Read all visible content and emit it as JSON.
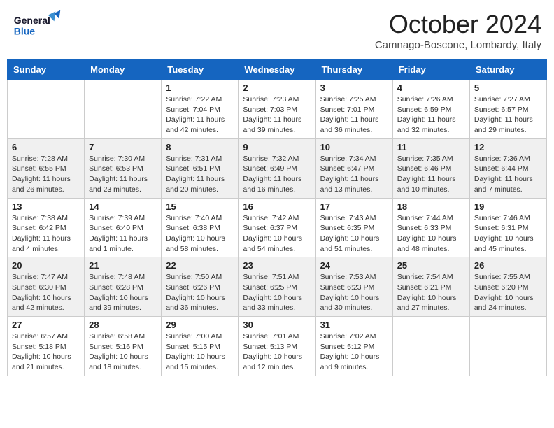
{
  "header": {
    "logo_general": "General",
    "logo_blue": "Blue",
    "month_title": "October 2024",
    "location": "Camnago-Boscone, Lombardy, Italy"
  },
  "weekdays": [
    "Sunday",
    "Monday",
    "Tuesday",
    "Wednesday",
    "Thursday",
    "Friday",
    "Saturday"
  ],
  "weeks": [
    [
      {
        "day": "",
        "sunrise": "",
        "sunset": "",
        "daylight": ""
      },
      {
        "day": "",
        "sunrise": "",
        "sunset": "",
        "daylight": ""
      },
      {
        "day": "1",
        "sunrise": "Sunrise: 7:22 AM",
        "sunset": "Sunset: 7:04 PM",
        "daylight": "Daylight: 11 hours and 42 minutes."
      },
      {
        "day": "2",
        "sunrise": "Sunrise: 7:23 AM",
        "sunset": "Sunset: 7:03 PM",
        "daylight": "Daylight: 11 hours and 39 minutes."
      },
      {
        "day": "3",
        "sunrise": "Sunrise: 7:25 AM",
        "sunset": "Sunset: 7:01 PM",
        "daylight": "Daylight: 11 hours and 36 minutes."
      },
      {
        "day": "4",
        "sunrise": "Sunrise: 7:26 AM",
        "sunset": "Sunset: 6:59 PM",
        "daylight": "Daylight: 11 hours and 32 minutes."
      },
      {
        "day": "5",
        "sunrise": "Sunrise: 7:27 AM",
        "sunset": "Sunset: 6:57 PM",
        "daylight": "Daylight: 11 hours and 29 minutes."
      }
    ],
    [
      {
        "day": "6",
        "sunrise": "Sunrise: 7:28 AM",
        "sunset": "Sunset: 6:55 PM",
        "daylight": "Daylight: 11 hours and 26 minutes."
      },
      {
        "day": "7",
        "sunrise": "Sunrise: 7:30 AM",
        "sunset": "Sunset: 6:53 PM",
        "daylight": "Daylight: 11 hours and 23 minutes."
      },
      {
        "day": "8",
        "sunrise": "Sunrise: 7:31 AM",
        "sunset": "Sunset: 6:51 PM",
        "daylight": "Daylight: 11 hours and 20 minutes."
      },
      {
        "day": "9",
        "sunrise": "Sunrise: 7:32 AM",
        "sunset": "Sunset: 6:49 PM",
        "daylight": "Daylight: 11 hours and 16 minutes."
      },
      {
        "day": "10",
        "sunrise": "Sunrise: 7:34 AM",
        "sunset": "Sunset: 6:47 PM",
        "daylight": "Daylight: 11 hours and 13 minutes."
      },
      {
        "day": "11",
        "sunrise": "Sunrise: 7:35 AM",
        "sunset": "Sunset: 6:46 PM",
        "daylight": "Daylight: 11 hours and 10 minutes."
      },
      {
        "day": "12",
        "sunrise": "Sunrise: 7:36 AM",
        "sunset": "Sunset: 6:44 PM",
        "daylight": "Daylight: 11 hours and 7 minutes."
      }
    ],
    [
      {
        "day": "13",
        "sunrise": "Sunrise: 7:38 AM",
        "sunset": "Sunset: 6:42 PM",
        "daylight": "Daylight: 11 hours and 4 minutes."
      },
      {
        "day": "14",
        "sunrise": "Sunrise: 7:39 AM",
        "sunset": "Sunset: 6:40 PM",
        "daylight": "Daylight: 11 hours and 1 minute."
      },
      {
        "day": "15",
        "sunrise": "Sunrise: 7:40 AM",
        "sunset": "Sunset: 6:38 PM",
        "daylight": "Daylight: 10 hours and 58 minutes."
      },
      {
        "day": "16",
        "sunrise": "Sunrise: 7:42 AM",
        "sunset": "Sunset: 6:37 PM",
        "daylight": "Daylight: 10 hours and 54 minutes."
      },
      {
        "day": "17",
        "sunrise": "Sunrise: 7:43 AM",
        "sunset": "Sunset: 6:35 PM",
        "daylight": "Daylight: 10 hours and 51 minutes."
      },
      {
        "day": "18",
        "sunrise": "Sunrise: 7:44 AM",
        "sunset": "Sunset: 6:33 PM",
        "daylight": "Daylight: 10 hours and 48 minutes."
      },
      {
        "day": "19",
        "sunrise": "Sunrise: 7:46 AM",
        "sunset": "Sunset: 6:31 PM",
        "daylight": "Daylight: 10 hours and 45 minutes."
      }
    ],
    [
      {
        "day": "20",
        "sunrise": "Sunrise: 7:47 AM",
        "sunset": "Sunset: 6:30 PM",
        "daylight": "Daylight: 10 hours and 42 minutes."
      },
      {
        "day": "21",
        "sunrise": "Sunrise: 7:48 AM",
        "sunset": "Sunset: 6:28 PM",
        "daylight": "Daylight: 10 hours and 39 minutes."
      },
      {
        "day": "22",
        "sunrise": "Sunrise: 7:50 AM",
        "sunset": "Sunset: 6:26 PM",
        "daylight": "Daylight: 10 hours and 36 minutes."
      },
      {
        "day": "23",
        "sunrise": "Sunrise: 7:51 AM",
        "sunset": "Sunset: 6:25 PM",
        "daylight": "Daylight: 10 hours and 33 minutes."
      },
      {
        "day": "24",
        "sunrise": "Sunrise: 7:53 AM",
        "sunset": "Sunset: 6:23 PM",
        "daylight": "Daylight: 10 hours and 30 minutes."
      },
      {
        "day": "25",
        "sunrise": "Sunrise: 7:54 AM",
        "sunset": "Sunset: 6:21 PM",
        "daylight": "Daylight: 10 hours and 27 minutes."
      },
      {
        "day": "26",
        "sunrise": "Sunrise: 7:55 AM",
        "sunset": "Sunset: 6:20 PM",
        "daylight": "Daylight: 10 hours and 24 minutes."
      }
    ],
    [
      {
        "day": "27",
        "sunrise": "Sunrise: 6:57 AM",
        "sunset": "Sunset: 5:18 PM",
        "daylight": "Daylight: 10 hours and 21 minutes."
      },
      {
        "day": "28",
        "sunrise": "Sunrise: 6:58 AM",
        "sunset": "Sunset: 5:16 PM",
        "daylight": "Daylight: 10 hours and 18 minutes."
      },
      {
        "day": "29",
        "sunrise": "Sunrise: 7:00 AM",
        "sunset": "Sunset: 5:15 PM",
        "daylight": "Daylight: 10 hours and 15 minutes."
      },
      {
        "day": "30",
        "sunrise": "Sunrise: 7:01 AM",
        "sunset": "Sunset: 5:13 PM",
        "daylight": "Daylight: 10 hours and 12 minutes."
      },
      {
        "day": "31",
        "sunrise": "Sunrise: 7:02 AM",
        "sunset": "Sunset: 5:12 PM",
        "daylight": "Daylight: 10 hours and 9 minutes."
      },
      {
        "day": "",
        "sunrise": "",
        "sunset": "",
        "daylight": ""
      },
      {
        "day": "",
        "sunrise": "",
        "sunset": "",
        "daylight": ""
      }
    ]
  ]
}
